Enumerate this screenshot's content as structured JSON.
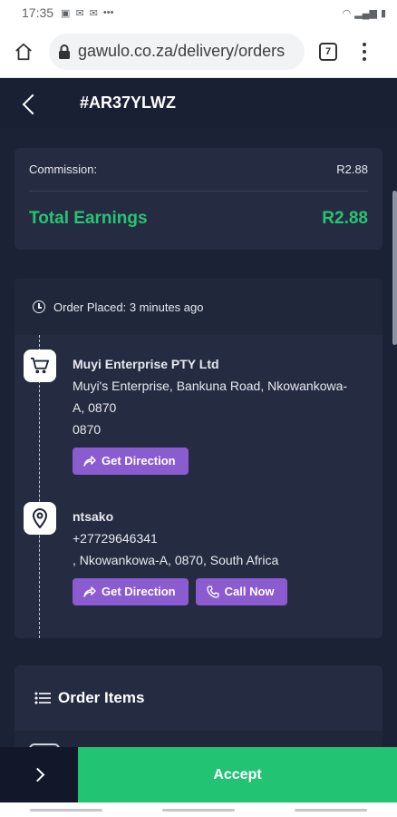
{
  "status_bar": {
    "time": "17:35",
    "dots": "•••"
  },
  "browser": {
    "url": "gawulo.co.za/delivery/orders",
    "tab_count": "7"
  },
  "header": {
    "order_id": "#AR37YLWZ"
  },
  "earnings": {
    "commission_label": "Commission:",
    "commission_value": "R2.88",
    "total_label": "Total Earnings",
    "total_value": "R2.88"
  },
  "order": {
    "placed_text": "Order Placed: 3 minutes ago",
    "pickup": {
      "name": "Muyi Enterprise PTY Ltd",
      "address_line1": "Muyi's Enterprise, Bankuna Road, Nkowankowa-",
      "address_line2": "A, 0870",
      "postal": "0870",
      "direction_label": "Get Direction",
      "icon": "shopping-cart-icon"
    },
    "dropoff": {
      "name": "ntsako",
      "phone": "+27729646341",
      "address": ", Nkowankowa-A, 0870, South Africa",
      "direction_label": "Get Direction",
      "call_label": "Call Now",
      "icon": "location-pin-icon"
    }
  },
  "items": {
    "title": "Order Items"
  },
  "actions": {
    "accept_label": "Accept"
  },
  "colors": {
    "accent_green": "#22c373",
    "accent_purple": "#8a5cd0",
    "background": "#1c2236",
    "card": "#252c42"
  }
}
